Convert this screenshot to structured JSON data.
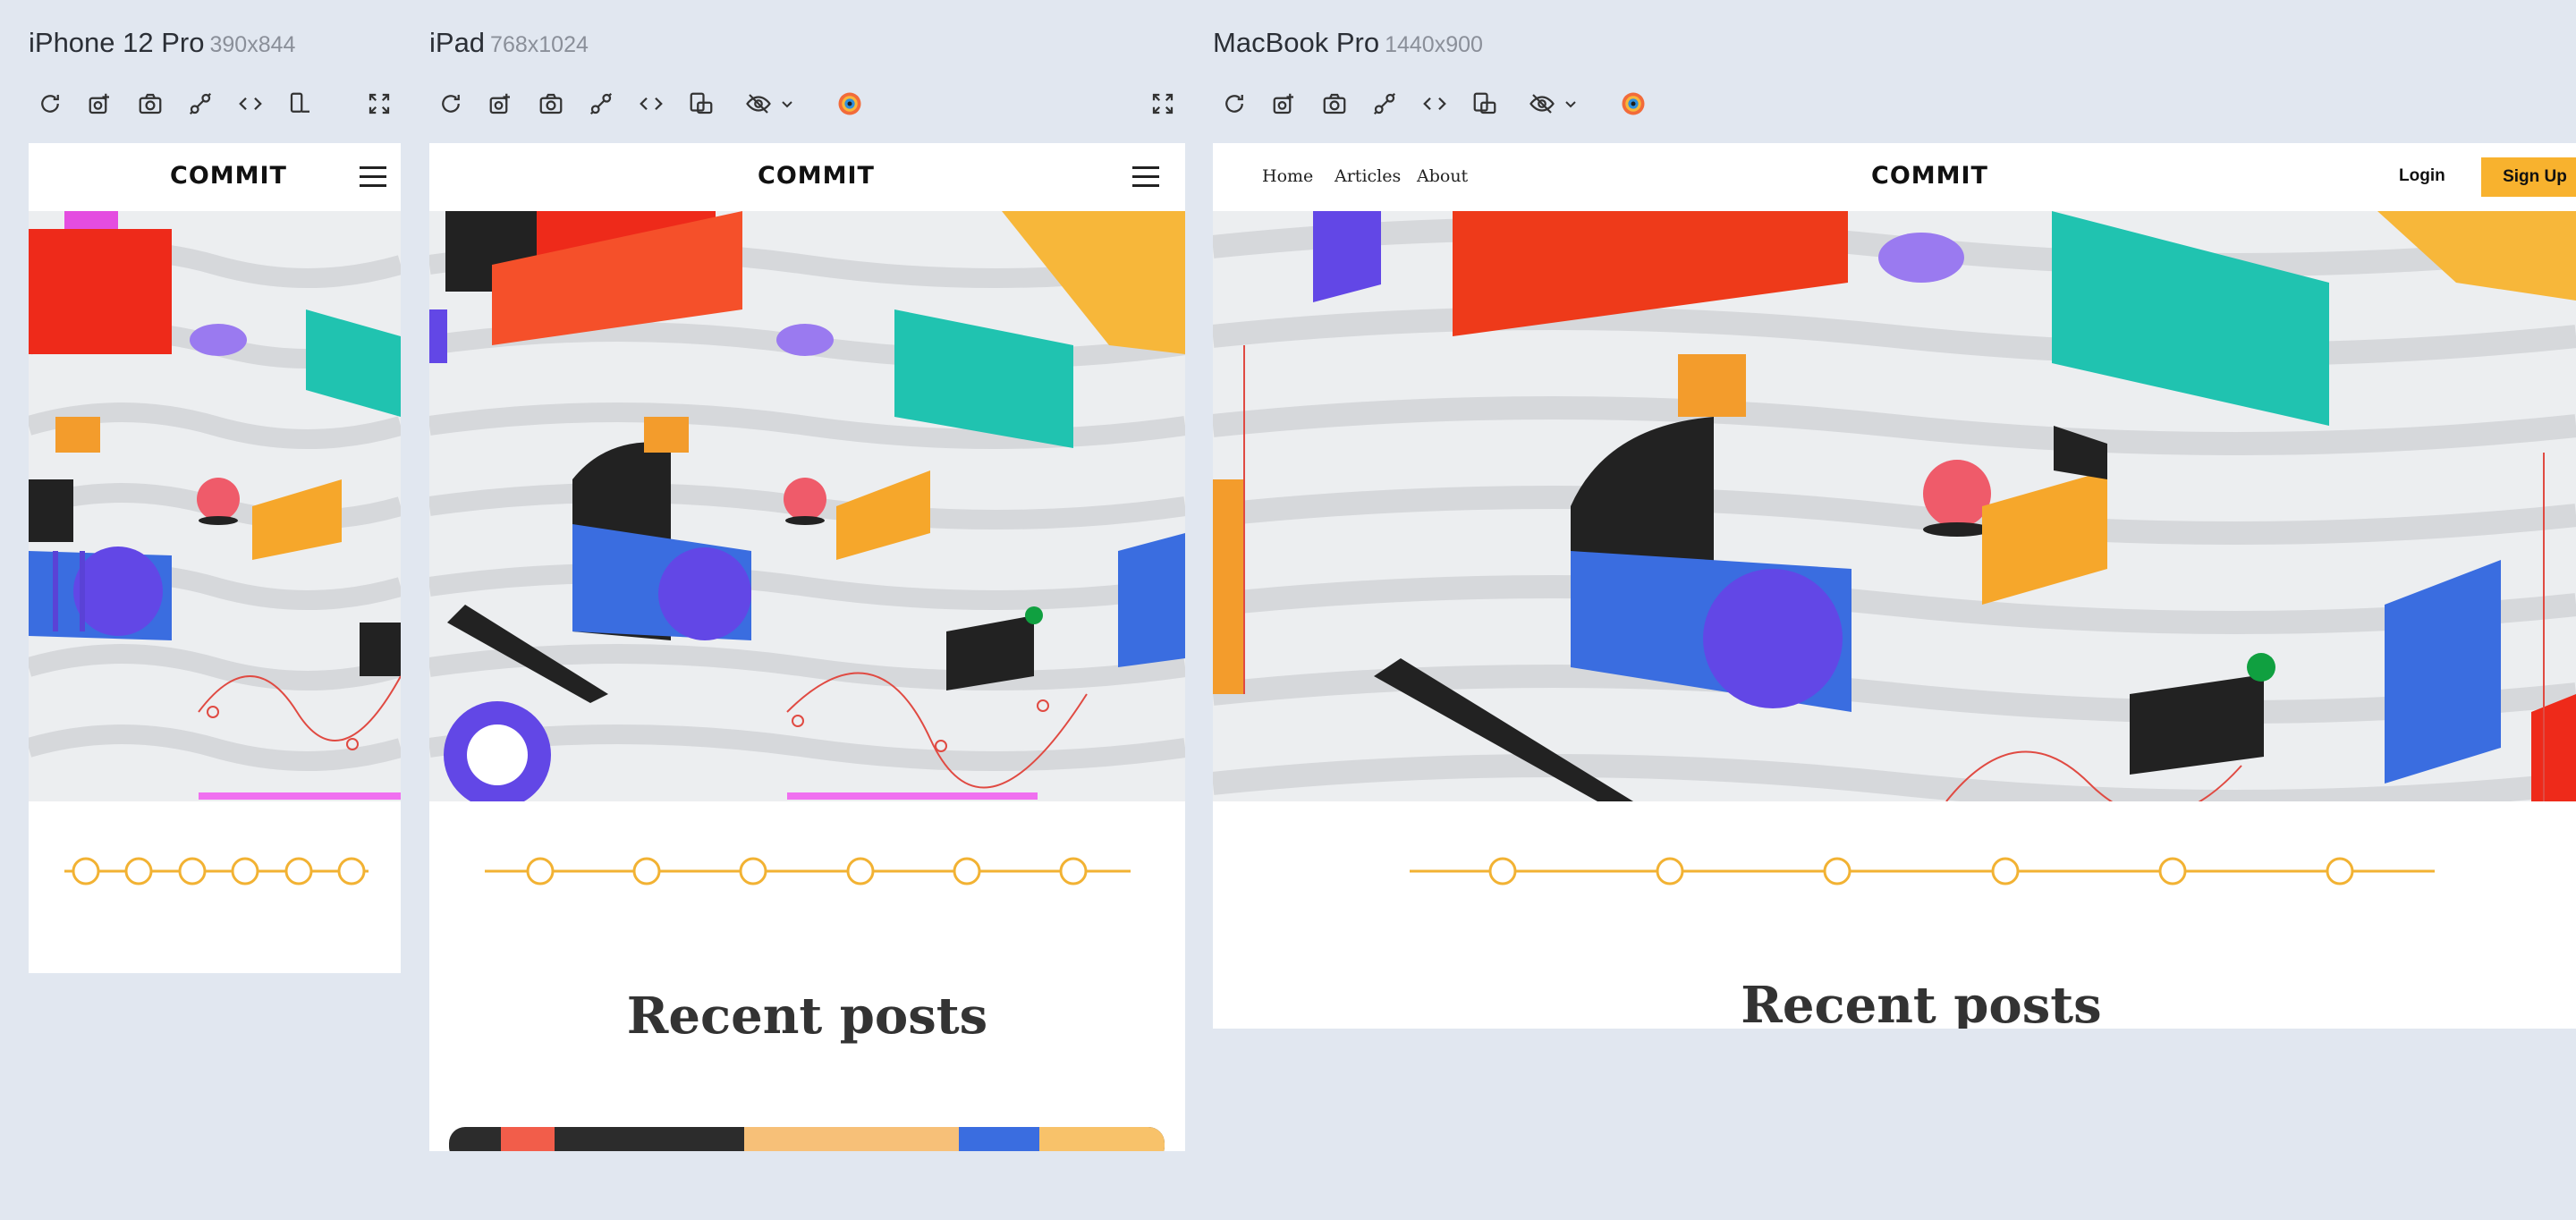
{
  "devices": [
    {
      "name": "iPhone 12 Pro",
      "size": "390x844"
    },
    {
      "name": "iPad",
      "size": "768x1024"
    },
    {
      "name": "MacBook Pro",
      "size": "1440x900"
    }
  ],
  "site": {
    "logo": "COMMIT",
    "nav": {
      "home": "Home",
      "articles": "Articles",
      "about": "About"
    },
    "login": "Login",
    "signup": "Sign Up",
    "recent_posts": "Recent posts"
  },
  "colors": {
    "canvas": "#e1e7f0",
    "accent_yellow": "#f8b22e",
    "hero_gray": "#eceef0",
    "red": "#ee2a1a",
    "purple": "#6247e6",
    "teal": "#20c3b0",
    "blue": "#3a6de0"
  },
  "toolbar_icons": [
    "reload-icon",
    "screenshot-all-icon",
    "camera-icon",
    "sync-scroll-icon",
    "code-icon",
    "rotate-device-icon",
    "hide-icon",
    "chevron-down-icon",
    "color-picker-icon",
    "fullscreen-icon"
  ]
}
